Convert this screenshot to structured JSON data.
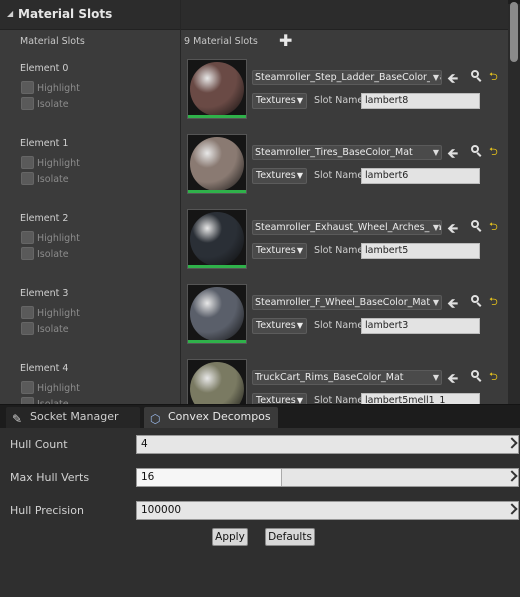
{
  "materials_panel": {
    "title": "Material Slots",
    "slots_label": "Material Slots",
    "slots_count": "9 Material Slots",
    "add_icon": "plus-icon",
    "elements": [
      {
        "label": "Element 0",
        "highlight": "Highlight",
        "isolate": "Isolate",
        "material": "Steamroller_Step_Ladder_BaseColor_Mat",
        "textures": "Textures",
        "slot_name_label": "Slot Name",
        "slot_name": "lambert8",
        "sphere_color": "#6a4a45"
      },
      {
        "label": "Element 1",
        "highlight": "Highlight",
        "isolate": "Isolate",
        "material": "Steamroller_Tires_BaseColor_Mat",
        "textures": "Textures",
        "slot_name_label": "Slot Name",
        "slot_name": "lambert6",
        "sphere_color": "#8a7a72"
      },
      {
        "label": "Element 2",
        "highlight": "Highlight",
        "isolate": "Isolate",
        "material": "Steamroller_Exhaust_Wheel_Arches_BaseColor_Mat",
        "textures": "Textures",
        "slot_name_label": "Slot Name",
        "slot_name": "lambert5",
        "sphere_color": "#2a2f36"
      },
      {
        "label": "Element 3",
        "highlight": "Highlight",
        "isolate": "Isolate",
        "material": "Steamroller_F_Wheel_BaseColor_Mat",
        "textures": "Textures",
        "slot_name_label": "Slot Name",
        "slot_name": "lambert3",
        "sphere_color": "#5a5f6a"
      },
      {
        "label": "Element 4",
        "highlight": "Highlight",
        "isolate": "Isolate",
        "material": "TruckCart_Rims_BaseColor_Mat",
        "textures": "Textures",
        "slot_name_label": "Slot Name",
        "slot_name": "lambert5mell1_1",
        "sphere_color": "#7a7a62"
      }
    ]
  },
  "tabs": [
    {
      "label": "Socket Manager",
      "icon": "socket-icon"
    },
    {
      "label": "Convex Decompos",
      "icon": "convex-icon"
    }
  ],
  "convex": {
    "hull_count_label": "Hull Count",
    "hull_count": "4",
    "max_hull_verts_label": "Max Hull Verts",
    "max_hull_verts": "16",
    "max_hull_verts_level": 0.38,
    "hull_precision_label": "Hull Precision",
    "hull_precision": "100000",
    "apply_label": "Apply",
    "defaults_label": "Defaults"
  }
}
